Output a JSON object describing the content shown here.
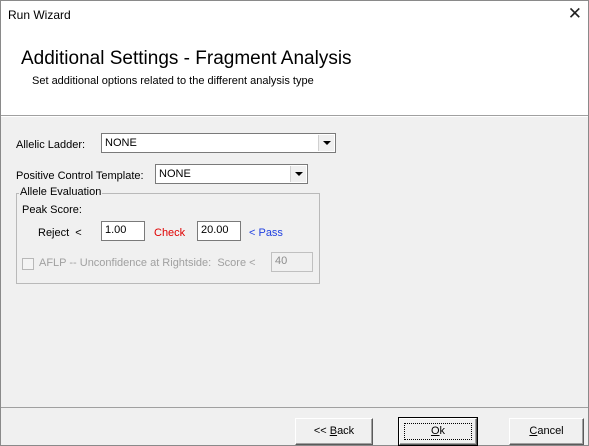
{
  "window": {
    "title": "Run Wizard",
    "close_glyph": "✕"
  },
  "header": {
    "title": "Additional Settings - Fragment Analysis",
    "subtitle": "Set additional options related to the different analysis type"
  },
  "form": {
    "allelic_ladder": {
      "label": "Allelic Ladder:",
      "value": "NONE"
    },
    "positive_control": {
      "label": "Positive Control Template:",
      "value": "NONE"
    },
    "allele_evaluation": {
      "legend": "Allele Evaluation",
      "peak_score_label": "Peak Score:",
      "reject_label": "Reject  <",
      "reject_value": "1.00",
      "check_label": "Check",
      "check_value": "20.00",
      "pass_label": "< Pass",
      "aflp": {
        "label": "AFLP -- Unconfidence at Rightside:  Score <",
        "value": "40",
        "checked": false,
        "enabled": false
      }
    }
  },
  "buttons": {
    "back": {
      "prefix": "<< ",
      "underline": "B",
      "rest": "ack"
    },
    "ok": {
      "underline": "O",
      "rest": "k"
    },
    "cancel": {
      "underline": "C",
      "rest": "ancel"
    }
  },
  "colors": {
    "check": "#e00000",
    "pass": "#1f3fe0",
    "dialog_bg": "#f0f0f0"
  }
}
